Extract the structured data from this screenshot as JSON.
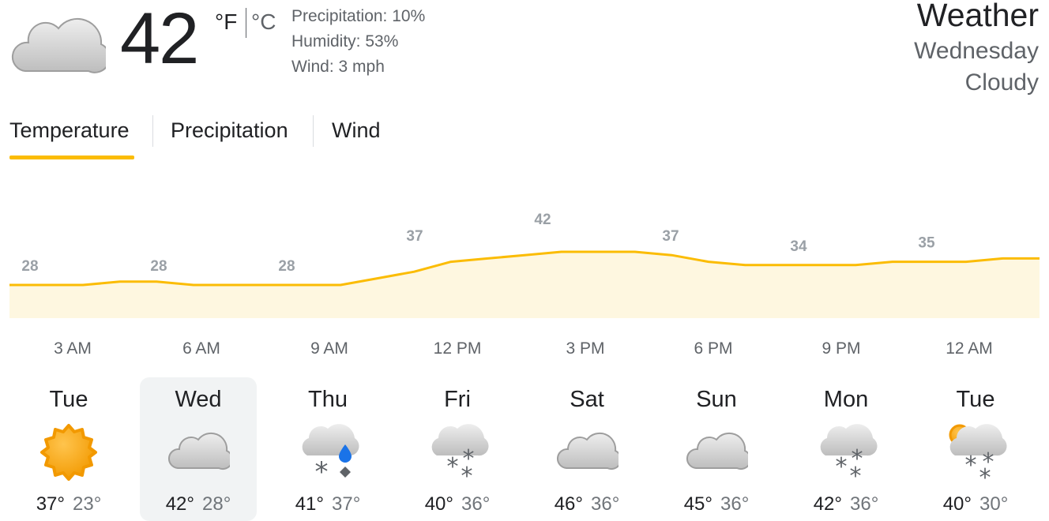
{
  "current": {
    "temperature": "42",
    "unit_f": "°F",
    "unit_c": "°C",
    "precipitation": "Precipitation: 10%",
    "humidity": "Humidity: 53%",
    "wind": "Wind: 3 mph",
    "icon": "cloudy-icon"
  },
  "header": {
    "title": "Weather",
    "day": "Wednesday",
    "condition": "Cloudy"
  },
  "tabs": [
    {
      "label": "Temperature",
      "selected": true
    },
    {
      "label": "Precipitation",
      "selected": false
    },
    {
      "label": "Wind",
      "selected": false
    }
  ],
  "colors": {
    "accent": "#fbbc04",
    "chart_fill": "#fef7e0",
    "label_gray": "#9aa0a6"
  },
  "chart_data": {
    "type": "area",
    "x": [
      "3 AM",
      "6 AM",
      "9 AM",
      "12 PM",
      "3 PM",
      "6 PM",
      "9 PM",
      "12 AM"
    ],
    "labels": [
      28,
      28,
      28,
      37,
      42,
      37,
      34,
      35
    ],
    "series": [
      {
        "values": [
          28,
          28,
          28,
          29,
          29,
          28,
          28,
          28,
          28,
          28,
          30,
          32,
          35,
          36,
          37,
          38,
          38,
          38,
          37,
          35,
          34,
          34,
          34,
          34,
          35,
          35,
          35,
          36,
          36
        ]
      }
    ]
  },
  "days": [
    {
      "name": "Tue",
      "high": "37°",
      "low": "23°",
      "icon": "sunny-icon",
      "selected": false
    },
    {
      "name": "Wed",
      "high": "42°",
      "low": "28°",
      "icon": "cloudy-icon",
      "selected": true
    },
    {
      "name": "Thu",
      "high": "41°",
      "low": "37°",
      "icon": "mixed-precipitation-icon",
      "selected": false
    },
    {
      "name": "Fri",
      "high": "40°",
      "low": "36°",
      "icon": "snow-icon",
      "selected": false
    },
    {
      "name": "Sat",
      "high": "46°",
      "low": "36°",
      "icon": "cloudy-icon",
      "selected": false
    },
    {
      "name": "Sun",
      "high": "45°",
      "low": "36°",
      "icon": "cloudy-icon",
      "selected": false
    },
    {
      "name": "Mon",
      "high": "42°",
      "low": "36°",
      "icon": "snow-icon",
      "selected": false
    },
    {
      "name": "Tue",
      "high": "40°",
      "low": "30°",
      "icon": "partly-cloudy-snow-icon",
      "selected": false
    }
  ]
}
